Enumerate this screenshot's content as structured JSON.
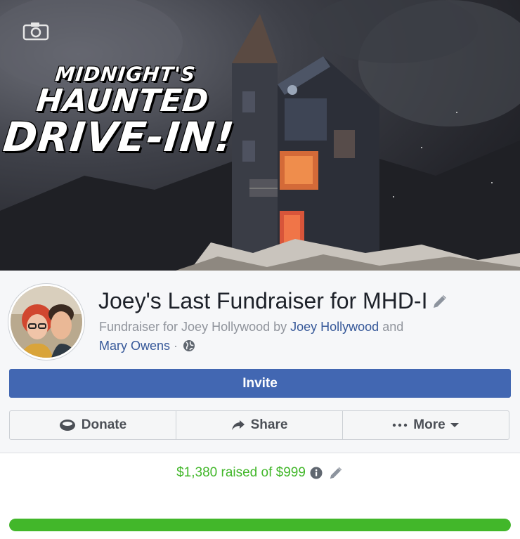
{
  "cover": {
    "title_line1": "MIDNIGHT'S",
    "title_line2": "HAUNTED",
    "title_line3": "DRIVE-IN!",
    "camera_icon": "camera-icon"
  },
  "fundraiser": {
    "title": "Joey's Last Fundraiser for MHD-I",
    "subtitle_prefix": "Fundraiser for Joey Hollywood by ",
    "organizer1": "Joey Hollywood",
    "and_text": " and",
    "organizer2": "Mary Owens",
    "separator": " · ",
    "privacy_icon": "globe-icon"
  },
  "buttons": {
    "invite": "Invite",
    "donate": "Donate",
    "share": "Share",
    "more": "More"
  },
  "progress": {
    "raised_text": "$1,380 raised of $999",
    "fraction": 1.0,
    "color": "#42b72a"
  },
  "colors": {
    "primary": "#4267b2",
    "link": "#365899",
    "muted": "#90949c",
    "success": "#42b72a"
  }
}
